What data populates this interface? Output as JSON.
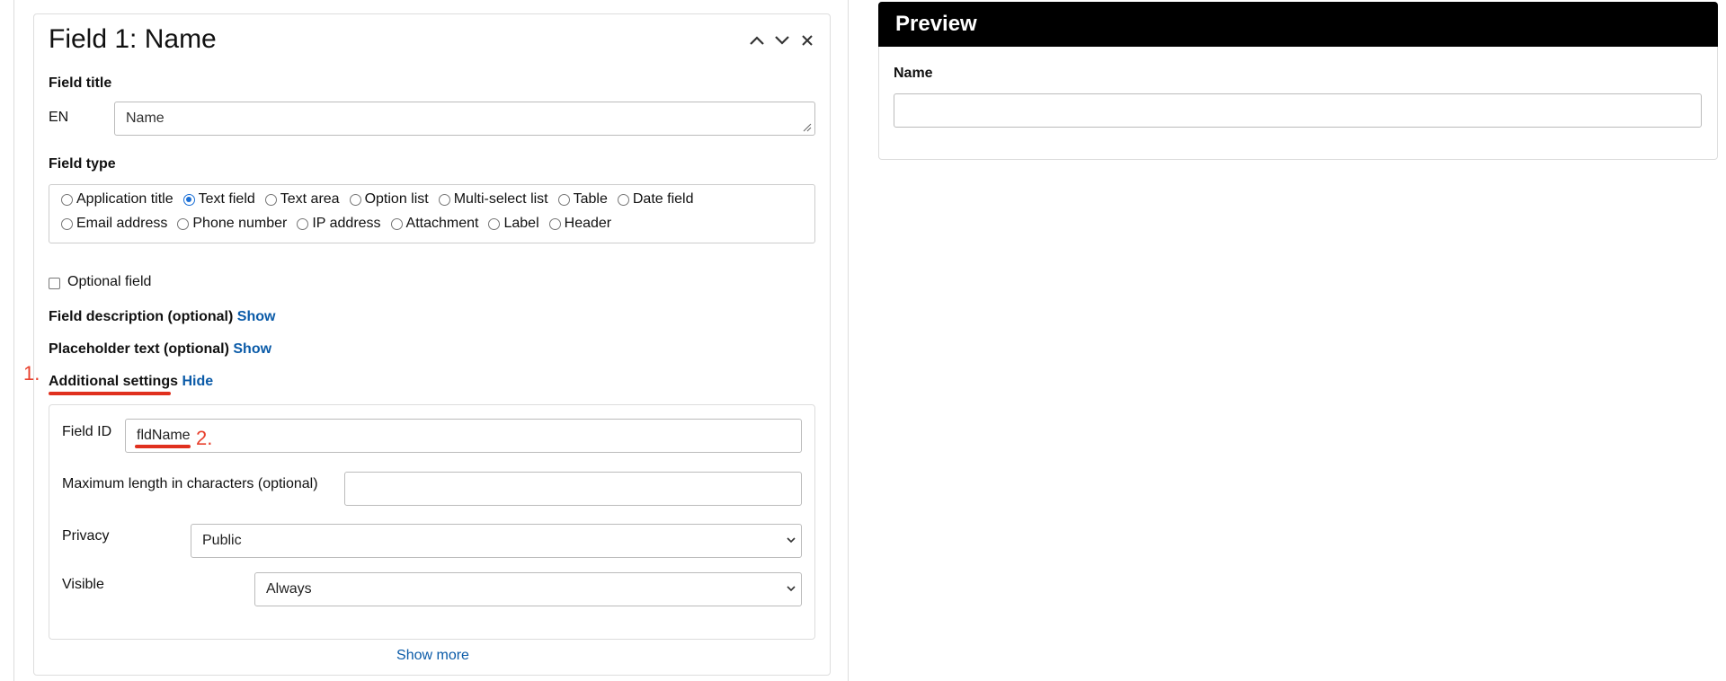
{
  "field": {
    "title": "Field 1: Name",
    "field_title_label": "Field title",
    "language_label": "EN",
    "title_value": "Name",
    "field_type_label": "Field type",
    "types_row1": [
      "Application title",
      "Text field",
      "Text area",
      "Option list",
      "Multi-select list",
      "Table",
      "Date field"
    ],
    "types_row2": [
      "Email address",
      "Phone number",
      "IP address",
      "Attachment",
      "Label",
      "Header"
    ],
    "selected_type": "Text field",
    "optional_label": "Optional field",
    "optional_checked": false,
    "description_label": "Field description (optional)",
    "description_link": "Show",
    "placeholder_label": "Placeholder text (optional)",
    "placeholder_link": "Show",
    "additional_label": "Additional settings",
    "additional_link": "Hide",
    "show_more": "Show more"
  },
  "settings": {
    "field_id_label": "Field ID",
    "field_id_value": "fldName",
    "max_length_label": "Maximum length in characters (optional)",
    "max_length_value": "",
    "privacy_label": "Privacy",
    "privacy_value": "Public",
    "visible_label": "Visible",
    "visible_value": "Always"
  },
  "annotations": {
    "marker1": "1.",
    "marker2": "2.",
    "color": "#e0301e"
  },
  "preview": {
    "header": "Preview",
    "field_label": "Name",
    "field_value": ""
  },
  "colors": {
    "link": "#0b5ba8",
    "radio_selected": "#1a6fd6",
    "preview_header_bg": "#000000"
  }
}
